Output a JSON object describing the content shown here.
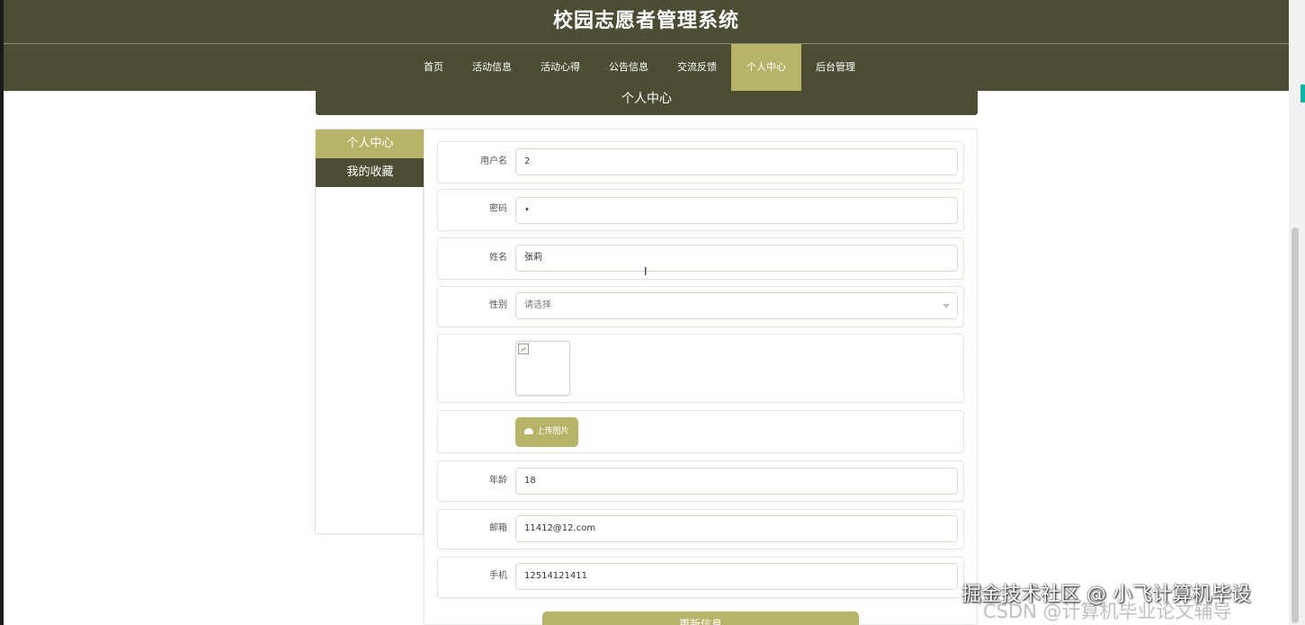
{
  "site": {
    "title": "校园志愿者管理系统"
  },
  "nav": {
    "items": [
      {
        "label": "首页"
      },
      {
        "label": "活动信息"
      },
      {
        "label": "活动心得"
      },
      {
        "label": "公告信息"
      },
      {
        "label": "交流反馈"
      },
      {
        "label": "个人中心",
        "active": true
      },
      {
        "label": "后台管理"
      }
    ]
  },
  "page": {
    "heading": "个人中心"
  },
  "sidebar": {
    "items": [
      {
        "label": "个人中心",
        "active": true
      },
      {
        "label": "我的收藏"
      }
    ]
  },
  "form": {
    "fields": [
      {
        "label": "用户名",
        "value": "2"
      },
      {
        "label": "密码",
        "value": "•"
      },
      {
        "label": "姓名",
        "value": "张莉"
      },
      {
        "label": "性别",
        "value": "请选择"
      },
      {
        "label": "年龄",
        "value": "18"
      },
      {
        "label": "邮箱",
        "value": "11412@12.com"
      },
      {
        "label": "手机",
        "value": "12514121411"
      }
    ],
    "upload_label": "上传图片",
    "submit_label": "更新信息"
  },
  "overlay": {
    "watermark": "掘金技术社区 @ 小飞计算机毕设",
    "watermark_sub": "CSDN @计算机毕业论文辅导"
  },
  "colors": {
    "primary_dark": "#4c4d33",
    "accent": "#b7b46a",
    "background": "#ffffff"
  },
  "icons": {
    "upload": "upload-icon",
    "select": "chevron-down-icon",
    "broken_image": "broken-image-icon",
    "text_cursor": "text-cursor-icon"
  }
}
